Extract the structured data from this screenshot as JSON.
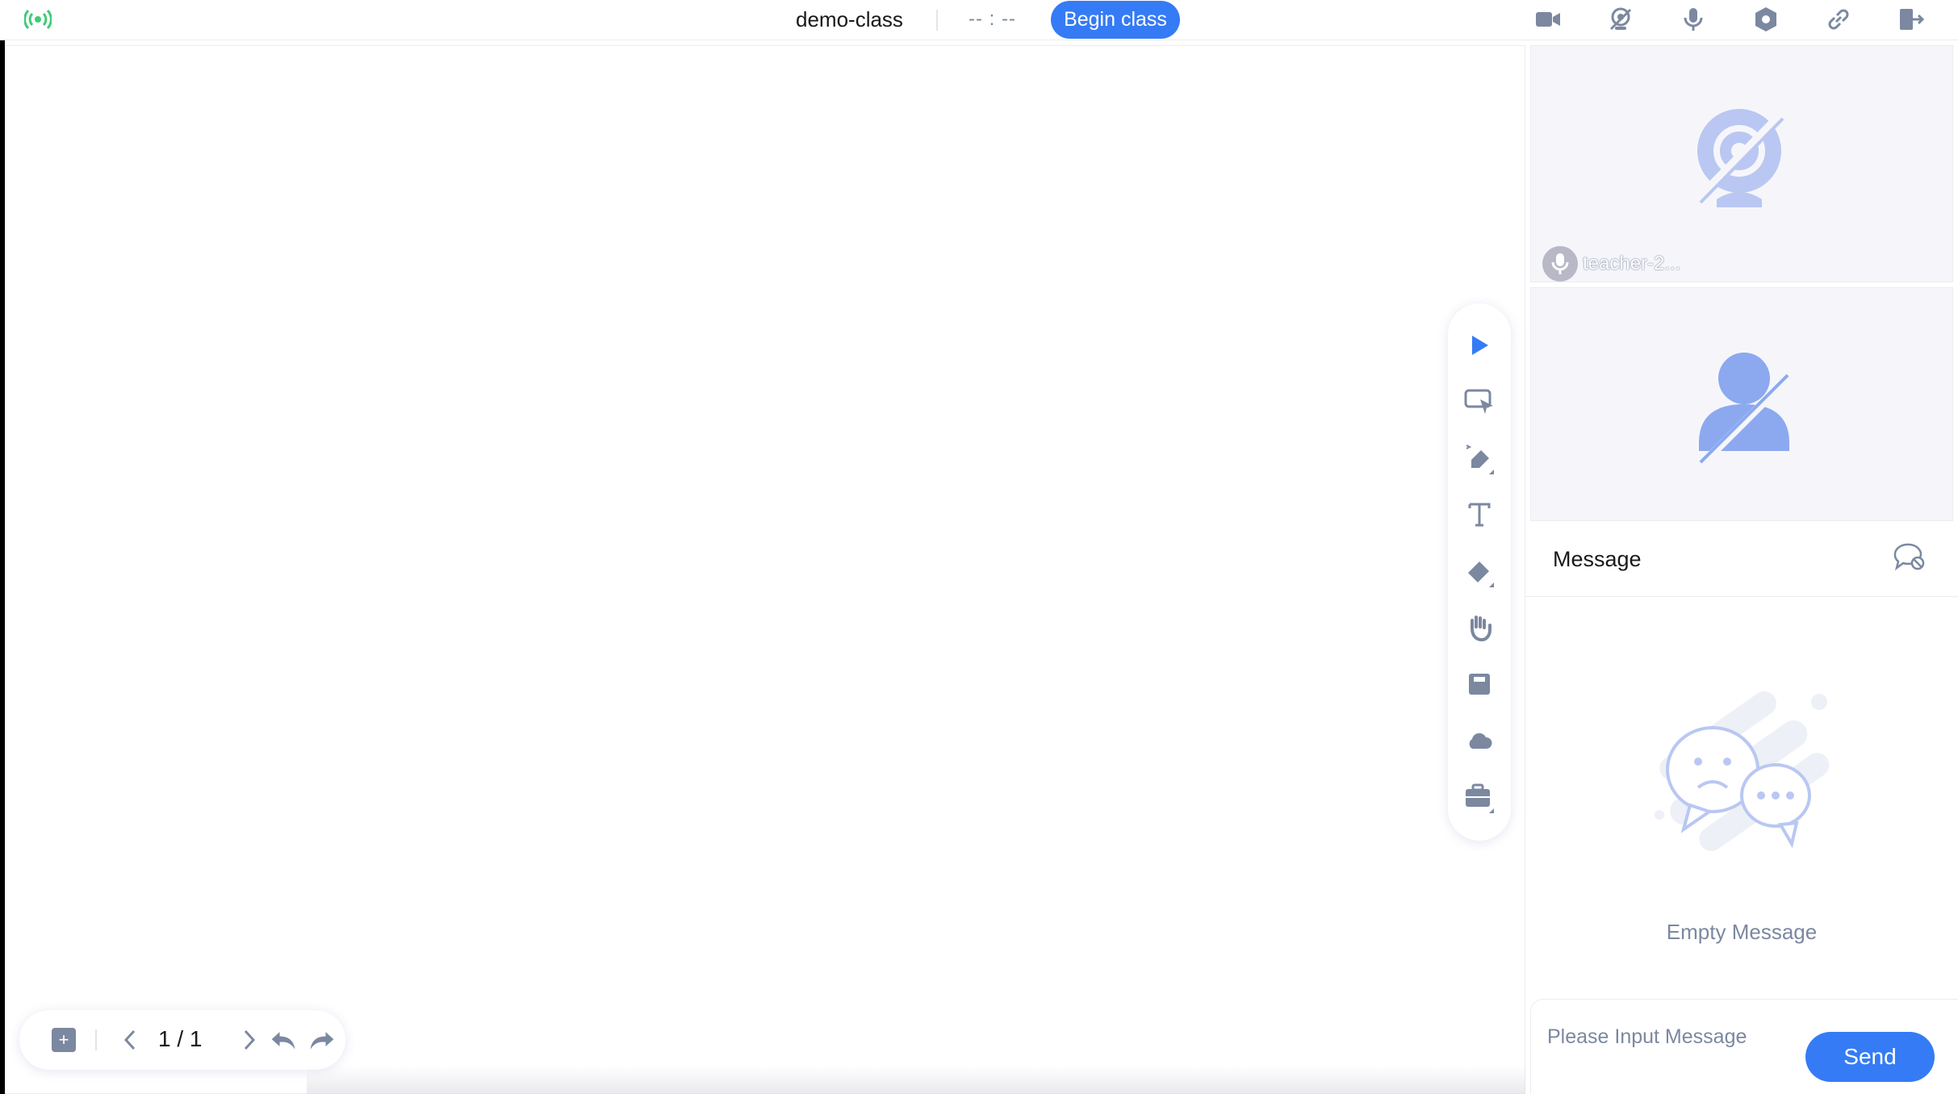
{
  "header": {
    "class_name": "demo-class",
    "timer": "-- : --",
    "begin_label": "Begin class",
    "icons": [
      "network-signal-icon",
      "camera-icon",
      "no-camera-icon",
      "microphone-icon",
      "settings-icon",
      "link-icon",
      "exit-icon"
    ]
  },
  "toolbar": {
    "tools": [
      "selector-icon",
      "laser-pointer-icon",
      "pen-icon",
      "text-icon",
      "eraser-icon",
      "hand-icon",
      "save-icon",
      "cloud-icon",
      "toolbox-icon"
    ]
  },
  "pager": {
    "page_label": "1 / 1"
  },
  "sidebar": {
    "teacher_name": "teacher-2...",
    "message_title": "Message",
    "empty_text": "Empty Message",
    "input_placeholder": "Please Input Message",
    "send_label": "Send"
  },
  "colors": {
    "accent": "#357bf6",
    "signal": "#3ecb77",
    "icon_gray": "#7b88a0",
    "avatar_blue": "#8ca9f0"
  }
}
